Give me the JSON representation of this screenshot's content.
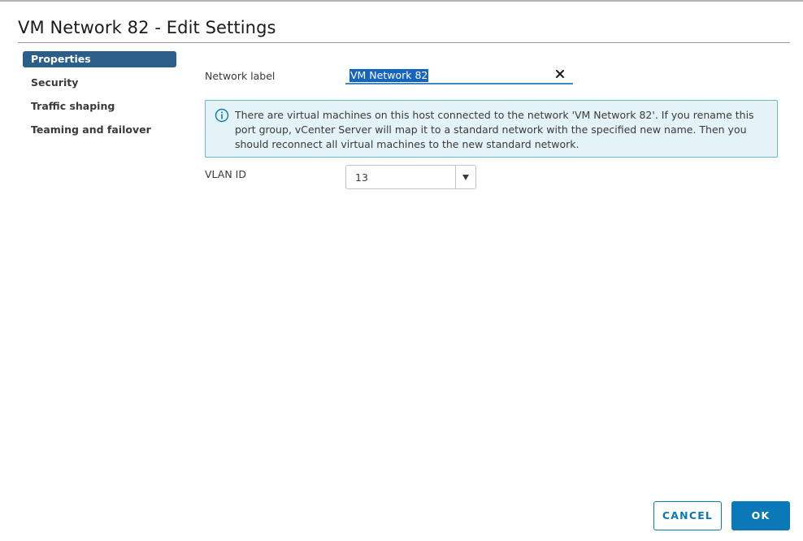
{
  "dialog": {
    "title": "VM Network 82 - Edit Settings"
  },
  "nav": {
    "items": [
      {
        "label": "Properties",
        "active": true
      },
      {
        "label": "Security",
        "active": false
      },
      {
        "label": "Traffic shaping",
        "active": false
      },
      {
        "label": "Teaming and failover",
        "active": false
      }
    ]
  },
  "form": {
    "network_label": {
      "label": "Network label",
      "value": "VM Network 82"
    },
    "info_message": "There are virtual machines on this host connected to the network 'VM Network 82'. If you rename this port group, vCenter Server will map it to a standard network with the specified new name. Then you should reconnect all virtual machines to the new standard network.",
    "vlan_id": {
      "label": "VLAN ID",
      "value": "13"
    }
  },
  "buttons": {
    "cancel": "CANCEL",
    "ok": "OK"
  },
  "icons": {
    "clear": "close-icon",
    "info": "info-icon",
    "dropdown": "caret-down-icon"
  },
  "colors": {
    "accent": "#0b79b8",
    "nav_active": "#2b5f8a",
    "info_bg": "#e3f3f7",
    "info_border": "#6fb5c9"
  }
}
